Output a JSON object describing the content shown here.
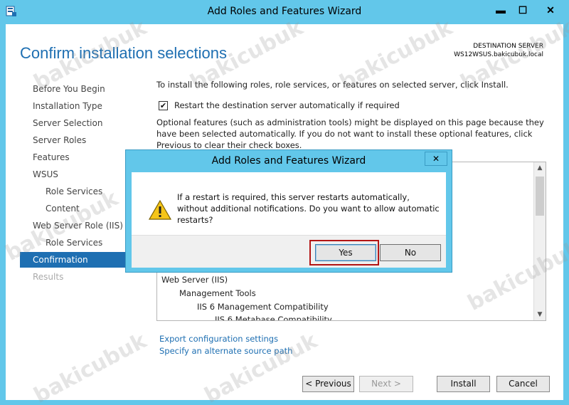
{
  "window": {
    "title": "Add Roles and Features Wizard",
    "controls": {
      "minimize": "▬",
      "maximize": "☐",
      "close": "✕"
    }
  },
  "header": {
    "page_title": "Confirm installation selections",
    "destination_label": "DESTINATION SERVER",
    "destination_server": "WS12WSUS.bakicubuk.local"
  },
  "nav": {
    "items": [
      {
        "label": "Before You Begin",
        "level": 0,
        "state": "normal"
      },
      {
        "label": "Installation Type",
        "level": 0,
        "state": "normal"
      },
      {
        "label": "Server Selection",
        "level": 0,
        "state": "normal"
      },
      {
        "label": "Server Roles",
        "level": 0,
        "state": "normal"
      },
      {
        "label": "Features",
        "level": 0,
        "state": "normal"
      },
      {
        "label": "WSUS",
        "level": 0,
        "state": "normal"
      },
      {
        "label": "Role Services",
        "level": 1,
        "state": "normal"
      },
      {
        "label": "Content",
        "level": 1,
        "state": "normal"
      },
      {
        "label": "Web Server Role (IIS)",
        "level": 0,
        "state": "normal"
      },
      {
        "label": "Role Services",
        "level": 1,
        "state": "normal"
      },
      {
        "label": "Confirmation",
        "level": 0,
        "state": "active"
      },
      {
        "label": "Results",
        "level": 0,
        "state": "disabled"
      }
    ]
  },
  "main": {
    "intro": "To install the following roles, role services, or features on selected server, click Install.",
    "restart_checkbox": {
      "label": "Restart the destination server automatically if required",
      "checked": true,
      "mark": "✔"
    },
    "optional_text": "Optional features (such as administration tools) might be displayed on this page because they have been selected automatically. If you do not want to install these optional features, click Previous to clear their check boxes.",
    "features": [
      {
        "label": "Web Server (IIS)",
        "level": 0
      },
      {
        "label": "Management Tools",
        "level": 1
      },
      {
        "label": "IIS 6 Management Compatibility",
        "level": 2
      },
      {
        "label": "IIS 6 Metabase Compatibility",
        "level": 3
      }
    ],
    "links": {
      "export": "Export configuration settings",
      "alternate_source": "Specify an alternate source path"
    }
  },
  "footer": {
    "previous": "< Previous",
    "next": "Next >",
    "install": "Install",
    "cancel": "Cancel"
  },
  "dialog": {
    "title": "Add Roles and Features Wizard",
    "close": "✕",
    "message": "If a restart is required, this server restarts automatically, without additional notifications. Do you want to allow automatic restarts?",
    "yes": "Yes",
    "no": "No"
  },
  "watermark": {
    "text": "bakicubuk"
  },
  "colors": {
    "frame": "#62c7ea",
    "accent": "#1e6fb2",
    "highlight_border": "#b31515"
  }
}
